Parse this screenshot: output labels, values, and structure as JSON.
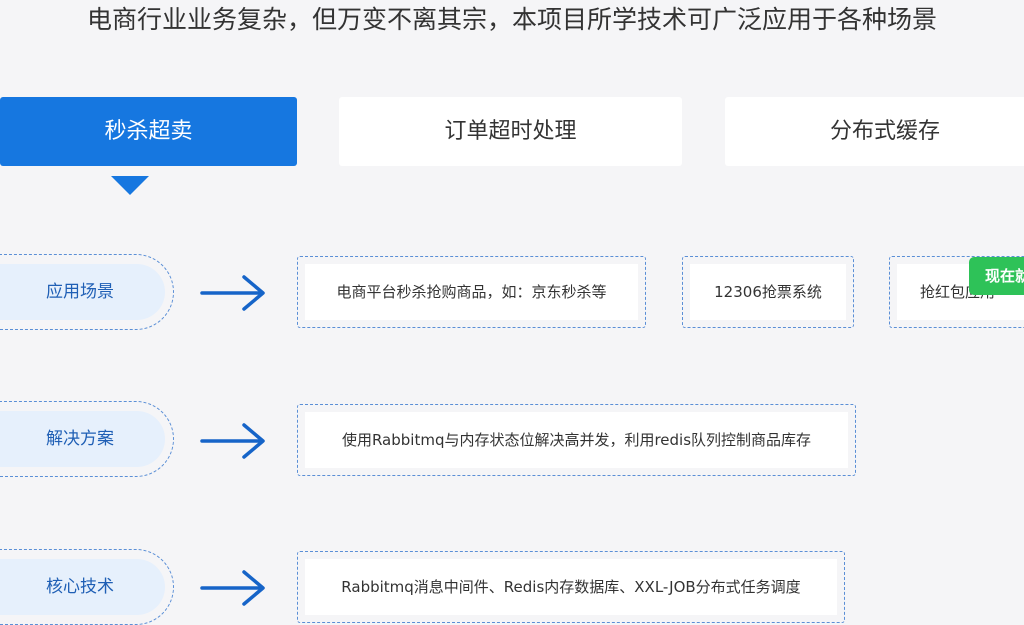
{
  "header": {
    "title": "电商行业业务复杂，但万变不离其宗，本项目所学技术可广泛应用于各种场景"
  },
  "tabs": [
    {
      "label": "秒杀超卖",
      "active": true
    },
    {
      "label": "订单超时处理",
      "active": false
    },
    {
      "label": "分布式缓存",
      "active": false
    }
  ],
  "rows": [
    {
      "label": "应用场景",
      "cards": [
        "电商平台秒杀抢购商品，如：京东秒杀等",
        "12306抢票系统",
        "抢红包应用"
      ]
    },
    {
      "label": "解决方案",
      "cards": [
        "使用Rabbitmq与内存状态位解决高并发，利用redis队列控制商品库存"
      ]
    },
    {
      "label": "核心技术",
      "cards": [
        "Rabbitmq消息中间件、Redis内存数据库、XXL-JOB分布式任务调度"
      ]
    }
  ],
  "floating_badge": {
    "label": "现在就"
  },
  "colors": {
    "accent": "#1677e0",
    "badge": "#2ec258",
    "label_text": "#1f5fb5",
    "label_bg": "#e6f0fc"
  },
  "icons": {
    "arrow": "arrow-right-icon",
    "indicator": "triangle-down-icon"
  }
}
